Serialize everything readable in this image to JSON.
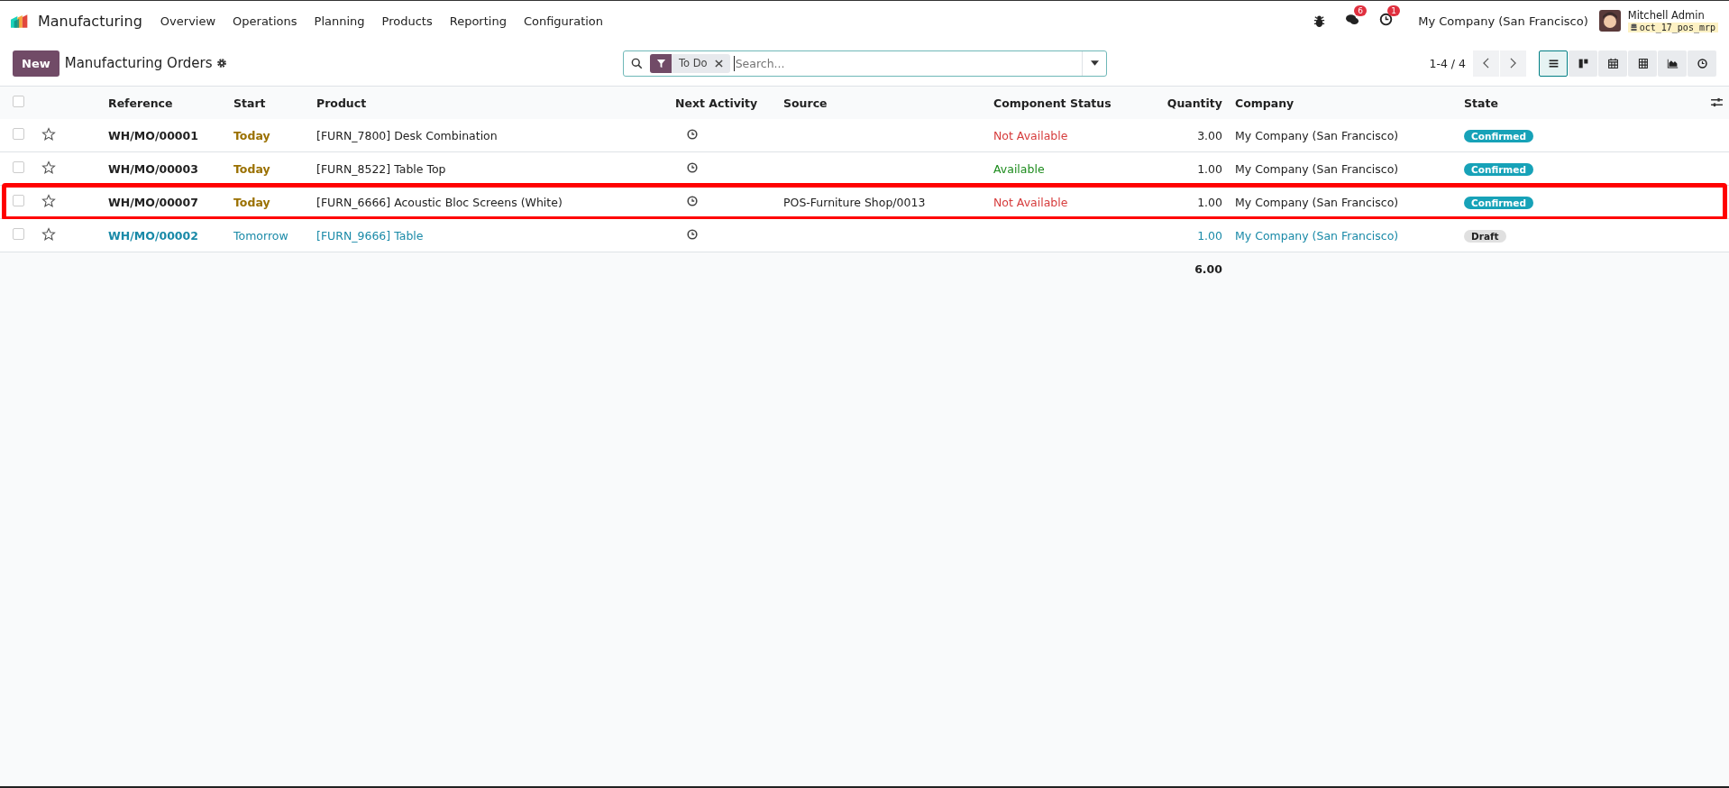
{
  "navbar": {
    "app_name": "Manufacturing",
    "menu": [
      "Overview",
      "Operations",
      "Planning",
      "Products",
      "Reporting",
      "Configuration"
    ],
    "messages_count": "6",
    "activities_count": "1",
    "company": "My Company (San Francisco)",
    "user": "Mitchell Admin",
    "database": "oct_17_pos_mrp"
  },
  "control_panel": {
    "new_button": "New",
    "title": "Manufacturing Orders",
    "search": {
      "facet": "To Do",
      "placeholder": "Search..."
    },
    "pager": "1-4 / 4",
    "views": [
      {
        "kind": "list",
        "selected": true
      },
      {
        "kind": "kanban",
        "selected": false
      },
      {
        "kind": "calendar",
        "selected": false
      },
      {
        "kind": "pivot",
        "selected": false
      },
      {
        "kind": "graph",
        "selected": false
      },
      {
        "kind": "activity",
        "selected": false
      }
    ]
  },
  "table": {
    "all_checked": false,
    "columns": [
      "Reference",
      "Start",
      "Product",
      "Next Activity",
      "Source",
      "Component Status",
      "Quantity",
      "Company",
      "State"
    ],
    "rows": [
      {
        "checked": false,
        "reference": "WH/MO/00001",
        "start": "Today",
        "product": "[FURN_7800] Desk Combination",
        "component_status": {
          "text": "Not Available",
          "kind": "not_available"
        },
        "quantity": "3.00",
        "company": "My Company (San Francisco)",
        "state": {
          "text": "Confirmed",
          "kind": "confirmed"
        },
        "draft": false,
        "highlighted": false
      },
      {
        "checked": false,
        "reference": "WH/MO/00003",
        "start": "Today",
        "product": "[FURN_8522] Table Top",
        "component_status": {
          "text": "Available",
          "kind": "available"
        },
        "quantity": "1.00",
        "company": "My Company (San Francisco)",
        "state": {
          "text": "Confirmed",
          "kind": "confirmed"
        },
        "draft": false,
        "highlighted": false
      },
      {
        "checked": false,
        "reference": "WH/MO/00007",
        "start": "Today",
        "product": "[FURN_6666] Acoustic Bloc Screens (White)",
        "source": "POS-Furniture Shop/0013",
        "component_status": {
          "text": "Not Available",
          "kind": "not_available"
        },
        "quantity": "1.00",
        "company": "My Company (San Francisco)",
        "state": {
          "text": "Confirmed",
          "kind": "confirmed"
        },
        "draft": false,
        "highlighted": true
      },
      {
        "checked": false,
        "reference": "WH/MO/00002",
        "start": "Tomorrow",
        "product": "[FURN_9666] Table",
        "quantity": "1.00",
        "company": "My Company (San Francisco)",
        "state": {
          "text": "Draft",
          "kind": "draft"
        },
        "draft": true,
        "highlighted": false
      }
    ],
    "total_quantity": "6.00"
  }
}
